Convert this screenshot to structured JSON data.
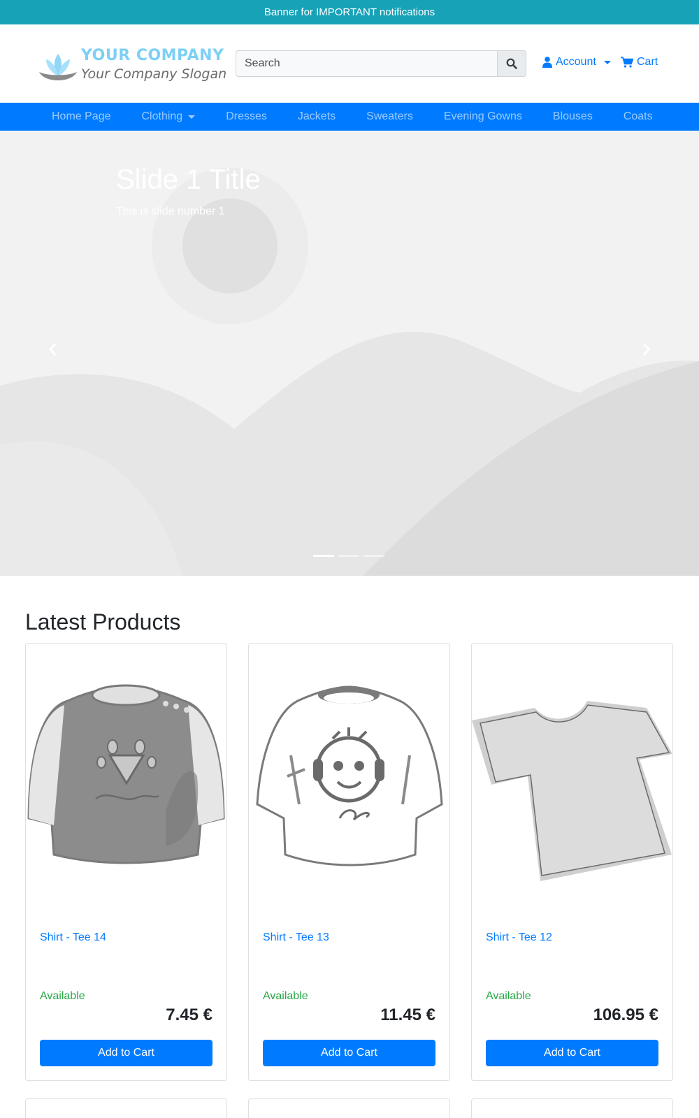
{
  "banner": {
    "text": "Banner for IMPORTANT notifications"
  },
  "logo": {
    "company": "YOUR COMPANY",
    "slogan": "Your Company Slogan"
  },
  "search": {
    "placeholder": "Search",
    "icon": "search-icon"
  },
  "account": {
    "label": "Account",
    "icon": "user-icon"
  },
  "cart": {
    "label": "Cart",
    "icon": "cart-icon"
  },
  "nav": {
    "items": [
      {
        "label": "Home Page"
      },
      {
        "label": "Clothing",
        "dropdown": true
      },
      {
        "label": "Dresses"
      },
      {
        "label": "Jackets"
      },
      {
        "label": "Sweaters"
      },
      {
        "label": "Evening Gowns"
      },
      {
        "label": "Blouses"
      },
      {
        "label": "Coats"
      }
    ]
  },
  "carousel": {
    "title": "Slide 1 Title",
    "subtitle": "This is slide number 1",
    "slide_count": 3,
    "active_slide": 1
  },
  "products_section": {
    "title": "Latest Products"
  },
  "products": [
    {
      "name": "Shirt - Tee 14",
      "availability": "Available",
      "price": "7.45 €",
      "button": "Add to Cart"
    },
    {
      "name": "Shirt - Tee 13",
      "availability": "Available",
      "price": "11.45 €",
      "button": "Add to Cart"
    },
    {
      "name": "Shirt - Tee 12",
      "availability": "Available",
      "price": "106.95 €",
      "button": "Add to Cart"
    }
  ],
  "colors": {
    "primary": "#007bff",
    "banner": "#17a2b8",
    "available": "#28a745",
    "logo": "#7dd0f5"
  }
}
